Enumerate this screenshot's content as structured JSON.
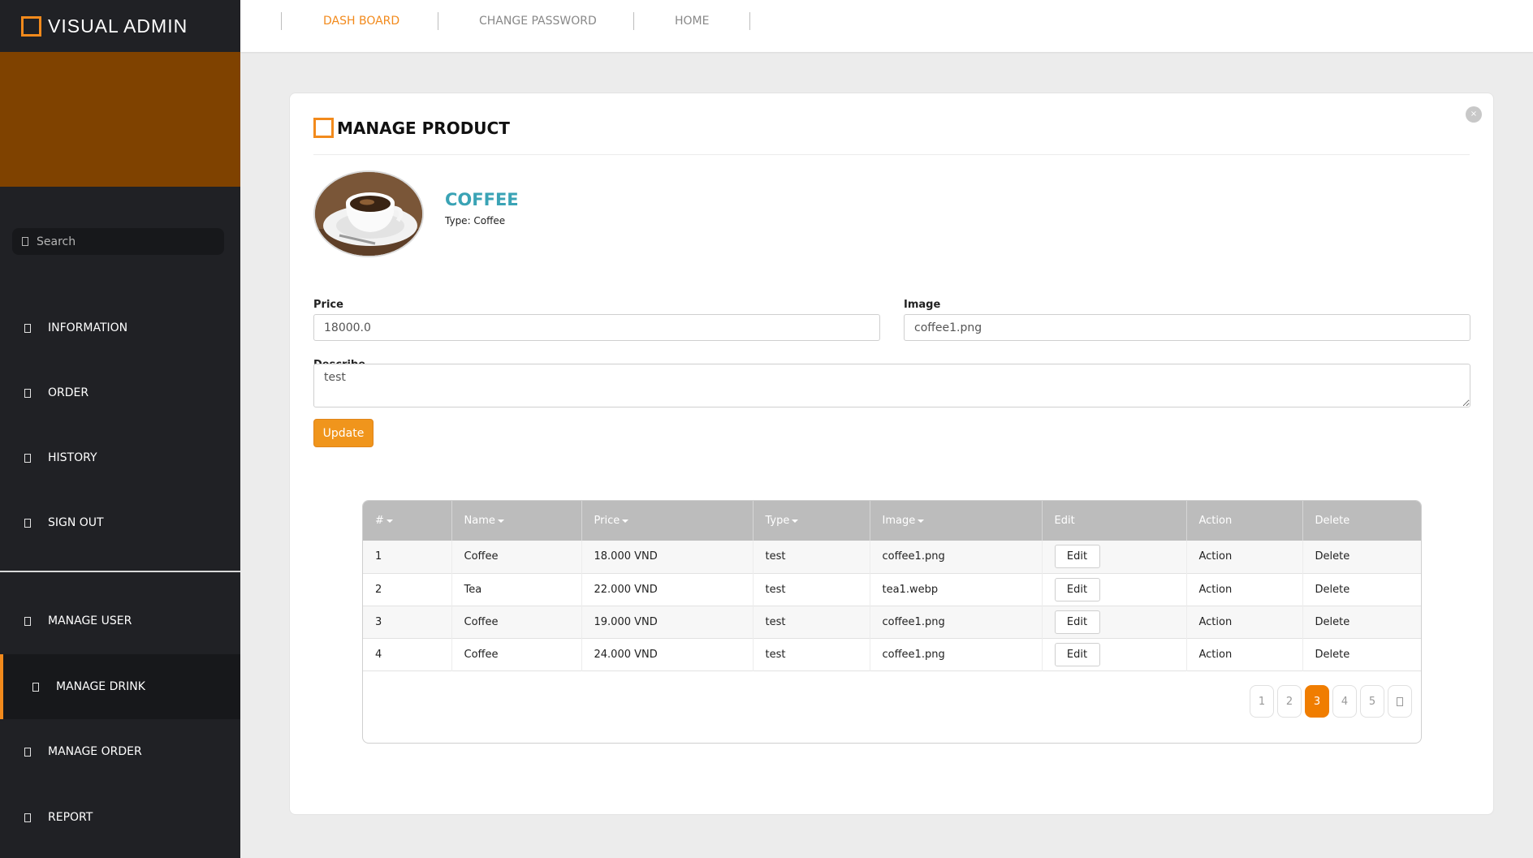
{
  "brand": {
    "title": "VISUAL ADMIN"
  },
  "sidebar": {
    "search_placeholder": "Search",
    "items": [
      {
        "label": "INFORMATION"
      },
      {
        "label": "ORDER"
      },
      {
        "label": "HISTORY"
      },
      {
        "label": "SIGN OUT"
      },
      {
        "label": "MANAGE USER"
      },
      {
        "label": "MANAGE DRINK",
        "active": true
      },
      {
        "label": "MANAGE ORDER"
      },
      {
        "label": "REPORT"
      }
    ]
  },
  "topnav": {
    "items": [
      {
        "label": "DASH BOARD",
        "active": true
      },
      {
        "label": "CHANGE PASSWORD"
      },
      {
        "label": "HOME"
      }
    ]
  },
  "card": {
    "title": "MANAGE PRODUCT",
    "product": {
      "name": "COFFEE",
      "type": "Type: Coffee"
    },
    "form": {
      "price_label": "Price",
      "price_value": "18000.0",
      "image_label": "Image",
      "image_value": "coffee1.png",
      "describe_label": "Describe",
      "describe_value": "test",
      "update_label": "Update"
    }
  },
  "table": {
    "headers": [
      "#",
      "Name",
      "Price",
      "Type",
      "Image",
      "Edit",
      "Action",
      "Delete"
    ],
    "rows": [
      {
        "no": "1",
        "name": "Coffee",
        "price": "18.000 VND",
        "type": "test",
        "image": "coffee1.png",
        "edit": "Edit",
        "action": "Action",
        "delete": "Delete"
      },
      {
        "no": "2",
        "name": "Tea",
        "price": "22.000 VND",
        "type": "test",
        "image": "tea1.webp",
        "edit": "Edit",
        "action": "Action",
        "delete": "Delete"
      },
      {
        "no": "3",
        "name": "Coffee",
        "price": "19.000 VND",
        "type": "test",
        "image": "coffee1.png",
        "edit": "Edit",
        "action": "Action",
        "delete": "Delete"
      },
      {
        "no": "4",
        "name": "Coffee",
        "price": "24.000 VND",
        "type": "test",
        "image": "coffee1.png",
        "edit": "Edit",
        "action": "Action",
        "delete": "Delete"
      }
    ]
  },
  "pagination": {
    "pages": [
      "1",
      "2",
      "3",
      "4",
      "5"
    ],
    "current": "3",
    "next_icon": "next-icon"
  },
  "colors": {
    "accent": "#f28a1c",
    "banner": "#7f4200",
    "sidebar": "#202125",
    "product_name": "#3aa3b5"
  }
}
